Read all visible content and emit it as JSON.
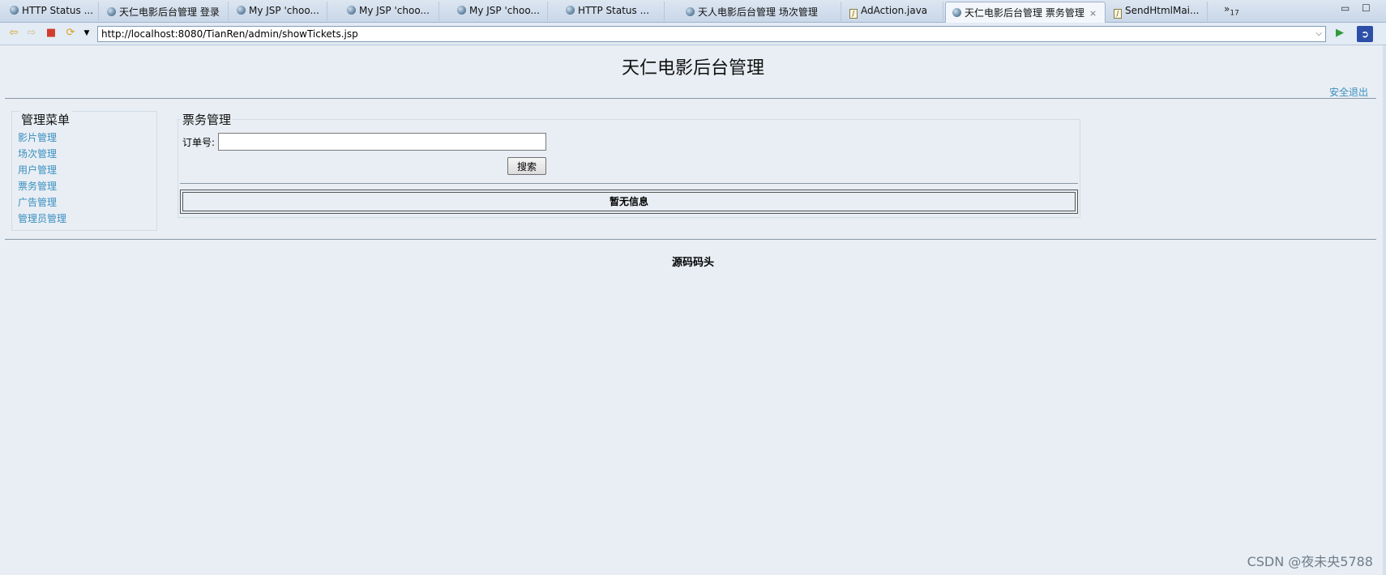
{
  "browser": {
    "tabs": [
      {
        "label": "HTTP Status ...",
        "icon": "globe-icon"
      },
      {
        "label": "天仁电影后台管理 登录",
        "icon": "globe-icon"
      },
      {
        "label": "My JSP 'choo...",
        "icon": "globe-icon"
      },
      {
        "label": "My JSP 'choo...",
        "icon": "globe-icon"
      },
      {
        "label": "My JSP 'choo...",
        "icon": "globe-icon"
      },
      {
        "label": "HTTP Status ...",
        "icon": "globe-icon"
      },
      {
        "label": "天人电影后台管理 场次管理",
        "icon": "globe-icon"
      },
      {
        "label": "AdAction.java",
        "icon": "java-file-icon"
      },
      {
        "label": "天仁电影后台管理 票务管理",
        "icon": "globe-icon",
        "active": true
      },
      {
        "label": "SendHtmlMai...",
        "icon": "java-file-icon"
      }
    ],
    "overflow_label": "»",
    "overflow_count": "17",
    "url": "http://localhost:8080/TianRen/admin/showTickets.jsp"
  },
  "page": {
    "title": "天仁电影后台管理",
    "logout": "安全退出",
    "menu": {
      "legend": "管理菜单",
      "items": [
        "影片管理",
        "场次管理",
        "用户管理",
        "票务管理",
        "广告管理",
        "管理员管理"
      ]
    },
    "tickets": {
      "legend": "票务管理",
      "order_label": "订单号:",
      "order_value": "",
      "search_button": "搜索",
      "empty_message": "暂无信息"
    },
    "footer": "源码码头"
  },
  "watermark": "CSDN @夜未央5788",
  "colors": {
    "background": "#e8eef4",
    "link": "#3b8fc0"
  }
}
